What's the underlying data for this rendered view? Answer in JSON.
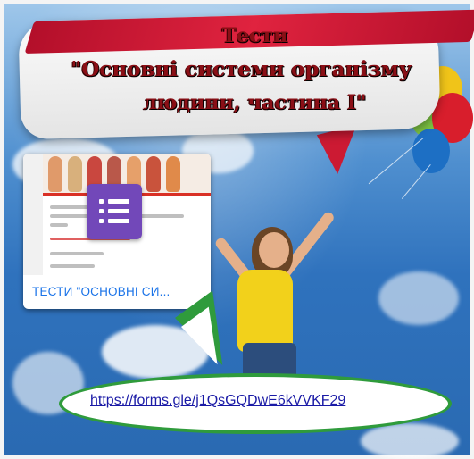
{
  "slide": {
    "title_line1": "Тести",
    "title_line2": "\"Основні системи організму",
    "title_line3": "людини, частина І\""
  },
  "form_card": {
    "label": "ТЕСТИ \"ОСНОВНІ СИ...",
    "icon": "google-forms-icon"
  },
  "link": {
    "url": "https://forms.gle/j1QsGQDwE6kVVKF29"
  },
  "colors": {
    "headline_text": "#8a0f16",
    "ribbon": "#cc1a33",
    "forms_purple": "#7248b9",
    "link_border": "#2f9b3c",
    "link_text": "#1a1aa6",
    "card_label": "#1a73e8"
  }
}
